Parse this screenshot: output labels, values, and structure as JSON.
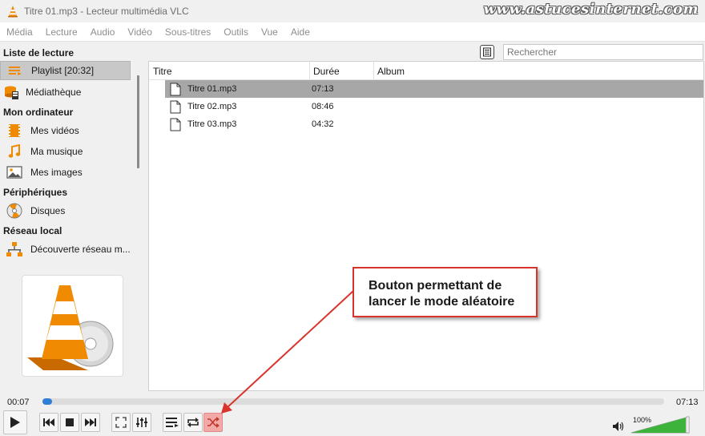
{
  "window": {
    "title": "Titre 01.mp3 - Lecteur multimédia VLC",
    "watermark": "www.astucesinternet.com"
  },
  "menu": [
    "Média",
    "Lecture",
    "Audio",
    "Vidéo",
    "Sous-titres",
    "Outils",
    "Vue",
    "Aide"
  ],
  "search": {
    "placeholder": "Rechercher"
  },
  "sidebar": {
    "sections": {
      "playlist_section": "Liste de lecture",
      "computer_section": "Mon ordinateur",
      "devices_section": "Périphériques",
      "network_section": "Réseau local"
    },
    "items": {
      "playlist": "Playlist [20:32]",
      "library": "Médiathèque",
      "videos": "Mes vidéos",
      "music": "Ma musique",
      "images": "Mes images",
      "disks": "Disques",
      "network": "Découverte réseau m..."
    }
  },
  "playlist": {
    "columns": {
      "title": "Titre",
      "duration": "Durée",
      "album": "Album"
    },
    "rows": [
      {
        "title": "Titre 01.mp3",
        "duration": "07:13"
      },
      {
        "title": "Titre 02.mp3",
        "duration": "08:46"
      },
      {
        "title": "Titre 03.mp3",
        "duration": "04:32"
      }
    ]
  },
  "player": {
    "elapsed": "00:07",
    "total": "07:13",
    "progress": 0.016,
    "volume": "100%",
    "volume_level": 1.0
  },
  "callout": {
    "line1": "Bouton permettant de",
    "line2": "lancer le mode aléatoire"
  },
  "colors": {
    "accent": "#2f7fd6",
    "callout_border": "#d9342b",
    "random_active": "#f4a9a9",
    "vlc_orange": "#f08a00"
  },
  "icons": [
    "vlc-cone-icon",
    "playlist-icon",
    "library-icon",
    "video-icon",
    "music-icon",
    "image-icon",
    "disc-icon",
    "network-icon",
    "file-icon",
    "play-icon",
    "previous-icon",
    "stop-icon",
    "next-icon",
    "fullscreen-icon",
    "equalizer-icon",
    "toggle-playlist-icon",
    "loop-icon",
    "shuffle-icon",
    "volume-icon"
  ]
}
